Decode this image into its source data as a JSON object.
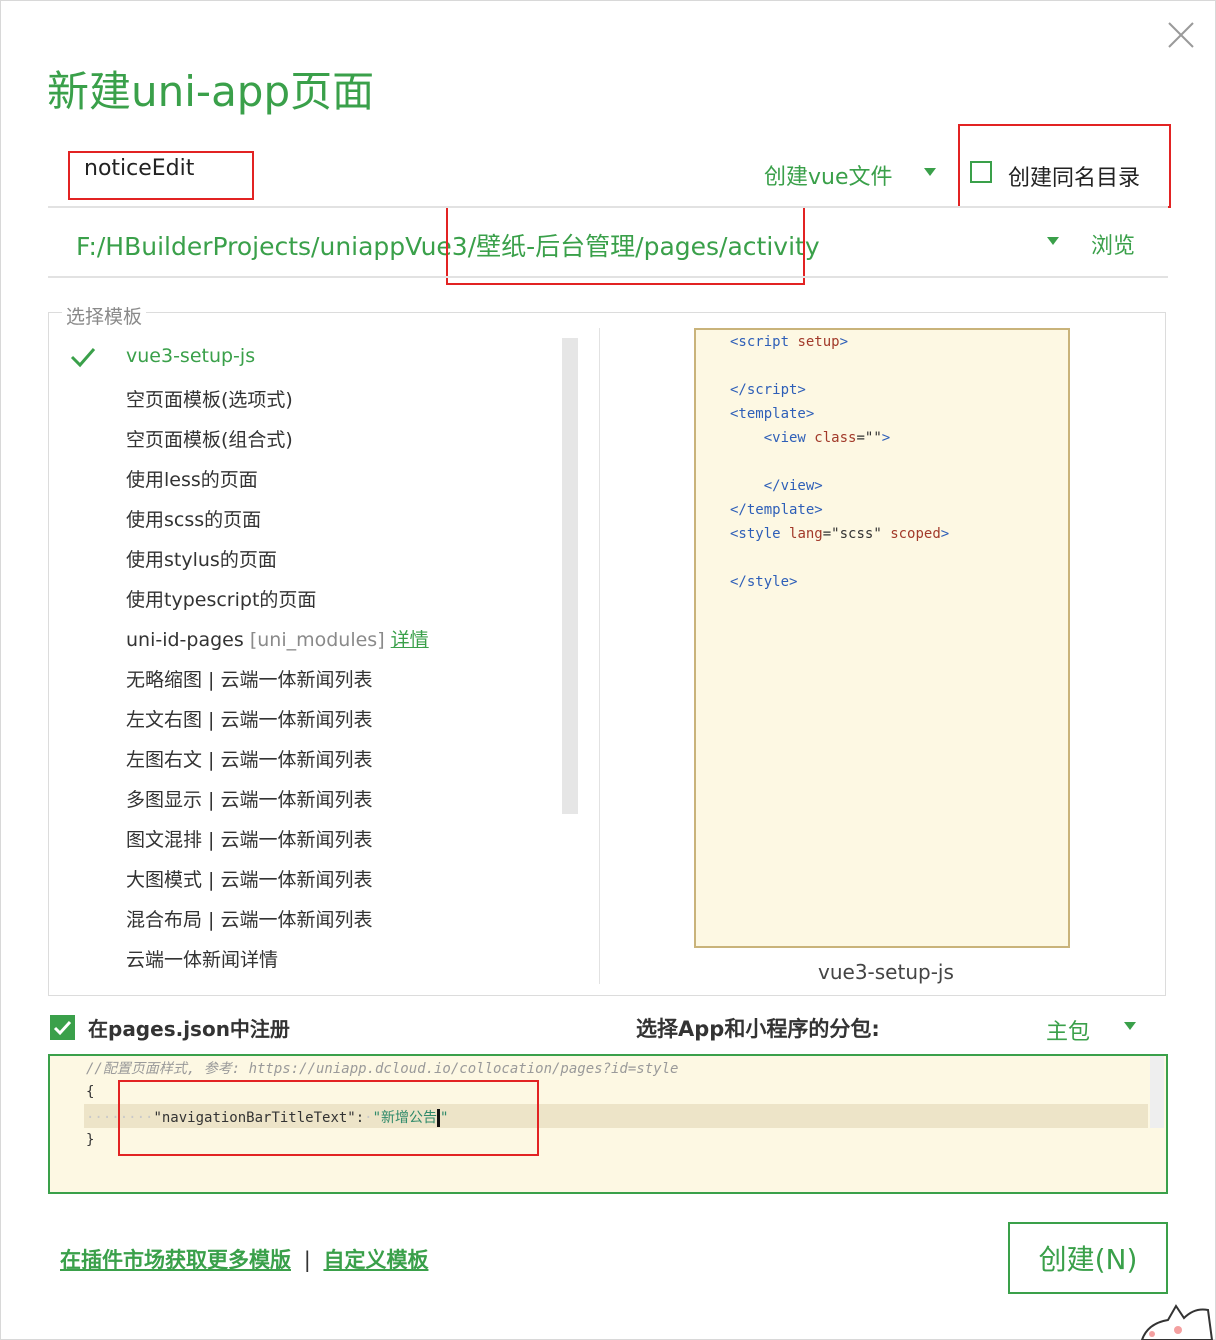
{
  "dialog": {
    "title": "新建uni-app页面",
    "page_name_value": "noticeEdit",
    "create_vue_label": "创建vue文件",
    "same_dir_label": "创建同名目录",
    "same_dir_checked": false,
    "path_value": "F:/HBuilderProjects/uniappVue3/壁纸-后台管理/pages/activity",
    "browse_label": "浏览"
  },
  "templates": {
    "legend": "选择模板",
    "items": [
      "vue3-setup-js",
      "空页面模板(选项式)",
      "空页面模板(组合式)",
      "使用less的页面",
      "使用scss的页面",
      "使用stylus的页面",
      "使用typescript的页面",
      "uni-id-pages",
      "无略缩图 | 云端一体新闻列表",
      "左文右图 | 云端一体新闻列表",
      "左图右文 | 云端一体新闻列表",
      "多图显示 | 云端一体新闻列表",
      "图文混排 | 云端一体新闻列表",
      "大图模式 | 云端一体新闻列表",
      "混合布局 | 云端一体新闻列表",
      "云端一体新闻详情"
    ],
    "uni_id_suffix": "[uni_modules]",
    "uni_id_link": "详情",
    "selected_index": 0
  },
  "preview": {
    "caption": "vue3-setup-js",
    "code": {
      "l1_tag": "<script",
      "l1_attr": "setup",
      "l1_end": ">",
      "l2": "</script>",
      "l3": "<template>",
      "l4_tag": "    <view",
      "l4_attr": "class",
      "l4_eq": "=",
      "l4_str": "\"\"",
      "l4_end": ">",
      "l5": "    </view>",
      "l6": "</template>",
      "l7_tag": "<style",
      "l7_attr1": "lang",
      "l7_eq": "=",
      "l7_str": "\"scss\"",
      "l7_attr2": "scoped",
      "l7_end": ">",
      "l8": "</style>"
    }
  },
  "register": {
    "checked": true,
    "label": "在pages.json中注册",
    "subpackage_label": "选择App和小程序的分包:",
    "subpackage_value": "主包"
  },
  "editor": {
    "comment": "//配置页面样式, 参考: https://uniapp.dcloud.io/collocation/pages?id=style",
    "open_brace": "{",
    "key": "\"navigationBarTitleText\"",
    "colon": ":",
    "value": "\"新增公告",
    "value_end": "\"",
    "close_brace": "}"
  },
  "footer": {
    "market_link": "在插件市场获取更多模版",
    "separator": "|",
    "custom_link": "自定义模板",
    "create_button": "创建(N)"
  },
  "colors": {
    "accent": "#3aa04a",
    "highlight": "#e22323",
    "preview_bg": "#fdf8e3"
  }
}
